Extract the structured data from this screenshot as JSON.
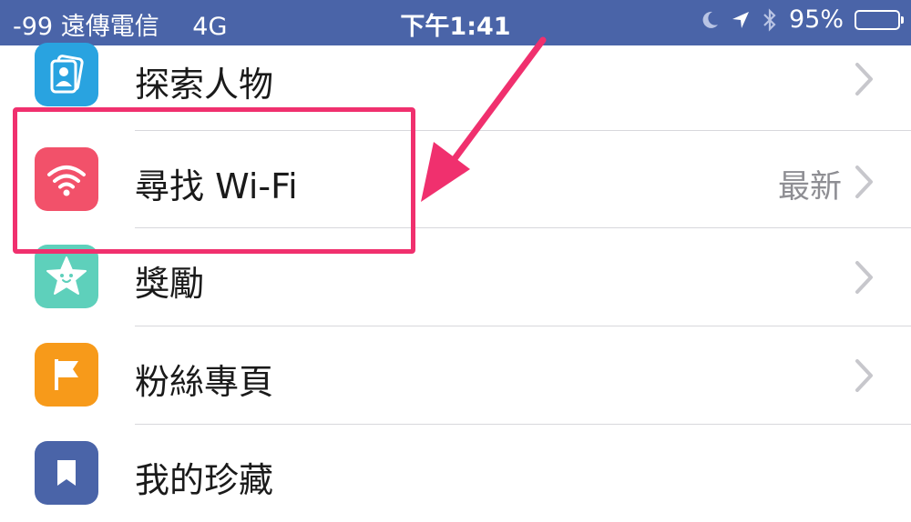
{
  "status_bar": {
    "signal": "-99",
    "carrier": "遠傳電信",
    "network": "4G",
    "time": "下午1:41",
    "battery": "95%",
    "battery_level": 0.95,
    "icons": [
      "moon-icon",
      "location-arrow-icon",
      "bluetooth-icon",
      "battery-icon"
    ]
  },
  "menu": {
    "items": [
      {
        "label": "探索人物",
        "detail": "",
        "icon": "people-card-icon",
        "color": "#29a3e0"
      },
      {
        "label": "尋找 Wi-Fi",
        "detail": "最新",
        "icon": "wifi-icon",
        "color": "#f2516a"
      },
      {
        "label": "獎勵",
        "detail": "",
        "icon": "star-face-icon",
        "color": "#5ed0bb"
      },
      {
        "label": "粉絲專頁",
        "detail": "",
        "icon": "flag-icon",
        "color": "#f79a1a"
      },
      {
        "label": "我的珍藏",
        "detail": "",
        "icon": "bookmark-icon",
        "color": "#4a64a8"
      }
    ]
  },
  "colors": {
    "status_bar": "#4a64a8",
    "annotation": "#f0306e",
    "chevron": "#c7c7cc",
    "divider": "#d8d8dc"
  }
}
